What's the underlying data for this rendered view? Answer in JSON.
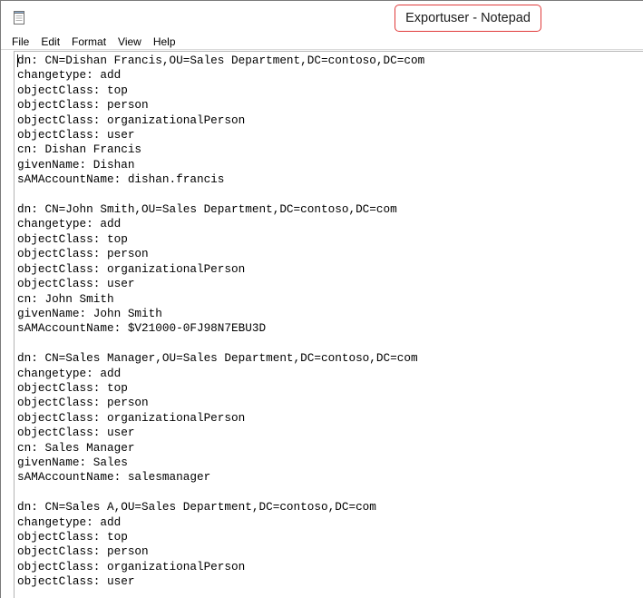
{
  "window": {
    "title": "Exportuser - Notepad",
    "icon": "notepad-icon",
    "annotation_color": "#e03a3a"
  },
  "menu": [
    "File",
    "Edit",
    "Format",
    "View",
    "Help"
  ],
  "document": {
    "lines": [
      "dn: CN=Dishan Francis,OU=Sales Department,DC=contoso,DC=com",
      "changetype: add",
      "objectClass: top",
      "objectClass: person",
      "objectClass: organizationalPerson",
      "objectClass: user",
      "cn: Dishan Francis",
      "givenName: Dishan",
      "sAMAccountName: dishan.francis",
      "",
      "dn: CN=John Smith,OU=Sales Department,DC=contoso,DC=com",
      "changetype: add",
      "objectClass: top",
      "objectClass: person",
      "objectClass: organizationalPerson",
      "objectClass: user",
      "cn: John Smith",
      "givenName: John Smith",
      "sAMAccountName: $V21000-0FJ98N7EBU3D",
      "",
      "dn: CN=Sales Manager,OU=Sales Department,DC=contoso,DC=com",
      "changetype: add",
      "objectClass: top",
      "objectClass: person",
      "objectClass: organizationalPerson",
      "objectClass: user",
      "cn: Sales Manager",
      "givenName: Sales",
      "sAMAccountName: salesmanager",
      "",
      "dn: CN=Sales A,OU=Sales Department,DC=contoso,DC=com",
      "changetype: add",
      "objectClass: top",
      "objectClass: person",
      "objectClass: organizationalPerson",
      "objectClass: user"
    ]
  }
}
